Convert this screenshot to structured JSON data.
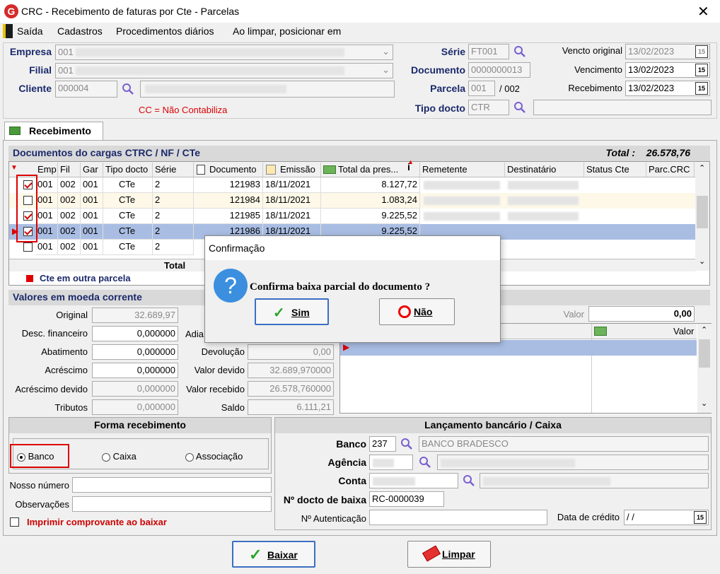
{
  "window": {
    "title": "CRC - Recebimento de faturas por Cte - Parcelas",
    "logo": "G"
  },
  "menu": {
    "items": [
      "Saída",
      "Cadastros",
      "Procedimentos diários",
      "Ao limpar, posicionar em"
    ]
  },
  "header": {
    "empresa_label": "Empresa",
    "empresa_value": "001",
    "filial_label": "Filial",
    "filial_value": "001",
    "cliente_label": "Cliente",
    "cliente_value": "000004",
    "cc_note": "CC = Não Contabiliza",
    "serie_label": "Série",
    "serie_value": "FT001",
    "documento_label": "Documento",
    "documento_value": "0000000013",
    "parcela_label": "Parcela",
    "parcela_value": "001",
    "parcela_total": "/ 002",
    "tipo_label": "Tipo docto",
    "tipo_value": "CTR",
    "vencto_original_label": "Vencto original",
    "vencto_original_value": "13/02/2023",
    "vencimento_label": "Vencimento",
    "vencimento_value": "13/02/2023",
    "recebimento_label": "Recebimento",
    "recebimento_value": "13/02/2023",
    "calendar_icon": "15"
  },
  "tab": {
    "label": "Recebimento"
  },
  "grid": {
    "title": "Documentos do cargas CTRC / NF / CTe",
    "total_label": "Total :",
    "total_value": "26.578,76",
    "columns": [
      "Emp",
      "Fil",
      "Gar",
      "Tipo docto",
      "Série",
      "Documento",
      "Emissão",
      "Total da pres...",
      "Remetente",
      "Destinatário",
      "Status Cte",
      "Parc.CRC"
    ],
    "rows": [
      {
        "checked": true,
        "emp": "001",
        "fil": "002",
        "gar": "001",
        "tipo": "CTe",
        "serie": "2",
        "doc": "121983",
        "emissao": "18/11/2021",
        "total": "8.127,72"
      },
      {
        "checked": false,
        "emp": "001",
        "fil": "002",
        "gar": "001",
        "tipo": "CTe",
        "serie": "2",
        "doc": "121984",
        "emissao": "18/11/2021",
        "total": "1.083,24"
      },
      {
        "checked": true,
        "emp": "001",
        "fil": "002",
        "gar": "001",
        "tipo": "CTe",
        "serie": "2",
        "doc": "121985",
        "emissao": "18/11/2021",
        "total": "9.225,52"
      },
      {
        "checked": true,
        "emp": "001",
        "fil": "002",
        "gar": "001",
        "tipo": "CTe",
        "serie": "2",
        "doc": "121986",
        "emissao": "18/11/2021",
        "total": "9.225,52"
      },
      {
        "checked": false,
        "emp": "001",
        "fil": "002",
        "gar": "001",
        "tipo": "CTe",
        "serie": "2",
        "doc": "",
        "emissao": "",
        "total": ""
      }
    ],
    "footer_total": "Total",
    "legend": "Cte em outra parcela",
    "legend_color": "#e00000"
  },
  "valores": {
    "title": "Valores em moeda corrente",
    "original_label": "Original",
    "original_value": "32.689,97",
    "desc_label": "Desc. financeiro",
    "desc_value": "0,000000",
    "abat_label": "Abatimento",
    "abat_value": "0,000000",
    "acres_label": "Acréscimo",
    "acres_value": "0,000000",
    "acresdev_label": "Acréscimo devido",
    "acresdev_value": "0,000000",
    "trib_label": "Tributos",
    "trib_value": "0,000000",
    "adia_label": "Adia",
    "devol_label": "Devolução",
    "devol_value": "0,00",
    "vdevido_label": "Valor devido",
    "vdevido_value": "32.689,970000",
    "vrecebido_label": "Valor recebido",
    "vrecebido_value": "26.578,760000",
    "saldo_label": "Saldo",
    "saldo_value": "6.111,21",
    "valor_label": "Valor",
    "valor_value": "0,00",
    "valor_col": "Valor"
  },
  "forma": {
    "title": "Forma recebimento",
    "options": [
      "Banco",
      "Caixa",
      "Associação"
    ],
    "selected": "Banco",
    "nosso_label": "Nosso número",
    "obs_label": "Observações",
    "imprimir_label": "Imprimir comprovante ao baixar"
  },
  "lancamento": {
    "title": "Lançamento bancário / Caixa",
    "banco_label": "Banco",
    "banco_value": "237",
    "banco_name": "BANCO BRADESCO",
    "agencia_label": "Agência",
    "conta_label": "Conta",
    "ndocto_label": "Nº docto de baixa",
    "ndocto_value": "RC-0000039",
    "nautent_label": "Nº Autenticação",
    "datacredito_label": "Data de crédito",
    "datacredito_value": " / /"
  },
  "dialog": {
    "title": "Confirmação",
    "message": "Confirma baixa parcial do documento ?",
    "yes_label": "Sim",
    "no_label": "Não"
  },
  "buttons": {
    "baixar_label": "Baixar",
    "limpar_label": "Limpar"
  }
}
